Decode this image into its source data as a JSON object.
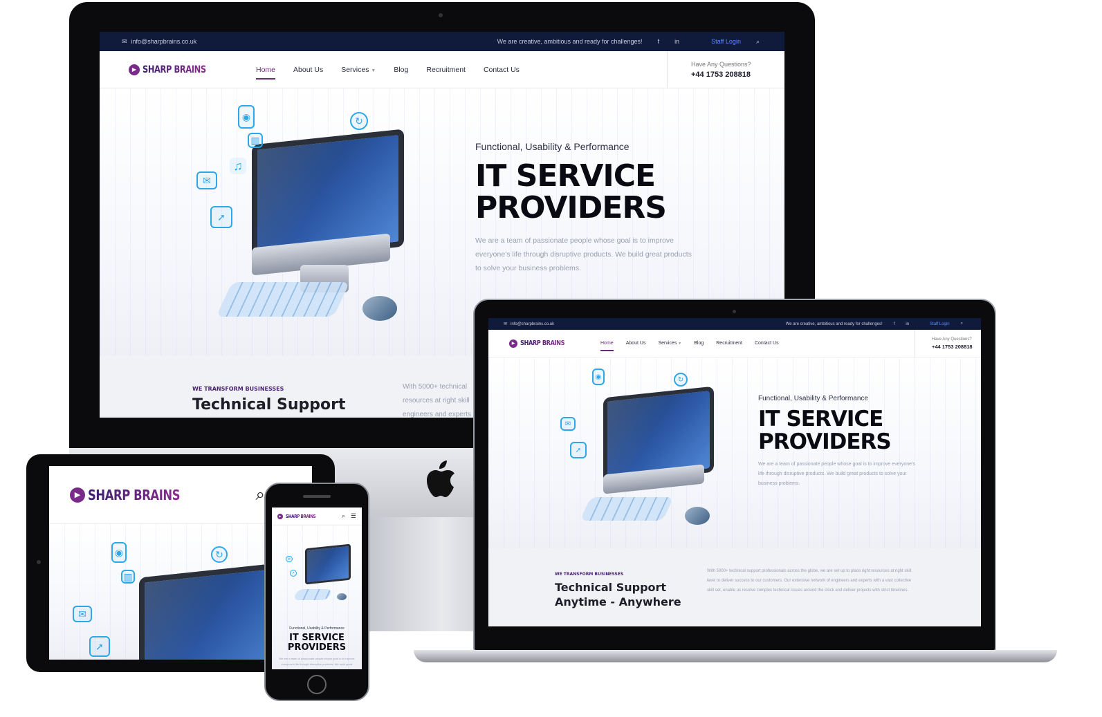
{
  "site": {
    "topbar": {
      "email": "info@sharpbrains.co.uk",
      "tagline": "We are creative, ambitious and ready for challenges!",
      "facebook": "f",
      "linkedin": "in",
      "staff_login": "Staff Login"
    },
    "logo": {
      "text": "SHARP BRAINS"
    },
    "menu": {
      "home": "Home",
      "about": "About Us",
      "services": "Services",
      "blog": "Blog",
      "recruitment": "Recruitment",
      "contact": "Contact Us"
    },
    "contact": {
      "question": "Have Any Questions?",
      "phone": "+44 1753 208818"
    },
    "hero": {
      "kicker": "Functional, Usability & Performance",
      "title_line1": "IT SERVICE",
      "title_line2": "PROVIDERS",
      "desc": "We are a team of passionate people whose goal is to improve everyone's life through disruptive products. We build great products to solve your business problems."
    },
    "band": {
      "kicker": "WE TRANSFORM BUSINESSES",
      "title_line1": "Technical Support",
      "title_line2": "Anytime - Anywhere",
      "desc": "With 5000+ technical support professionals across the globe, we are set up to place right resources at right skill level to deliver success to our customers. Our extensive network of engineers and experts with a vast collective skill set, enable us resolve complex technical issues around the clock and deliver projects with strict timelines.",
      "desc_cut": "With 5000+ technical resources at right skill engineers and experts"
    },
    "colors": {
      "topbar": "#101a3b",
      "brand": "#6a2a7a",
      "accent_icon": "#2ea6e8",
      "staff_login": "#5b8cff"
    }
  },
  "icons": [
    "email-icon",
    "facebook-icon",
    "linkedin-icon",
    "search-icon",
    "menu-icon",
    "chevron-down-icon",
    "apple-logo-icon"
  ]
}
